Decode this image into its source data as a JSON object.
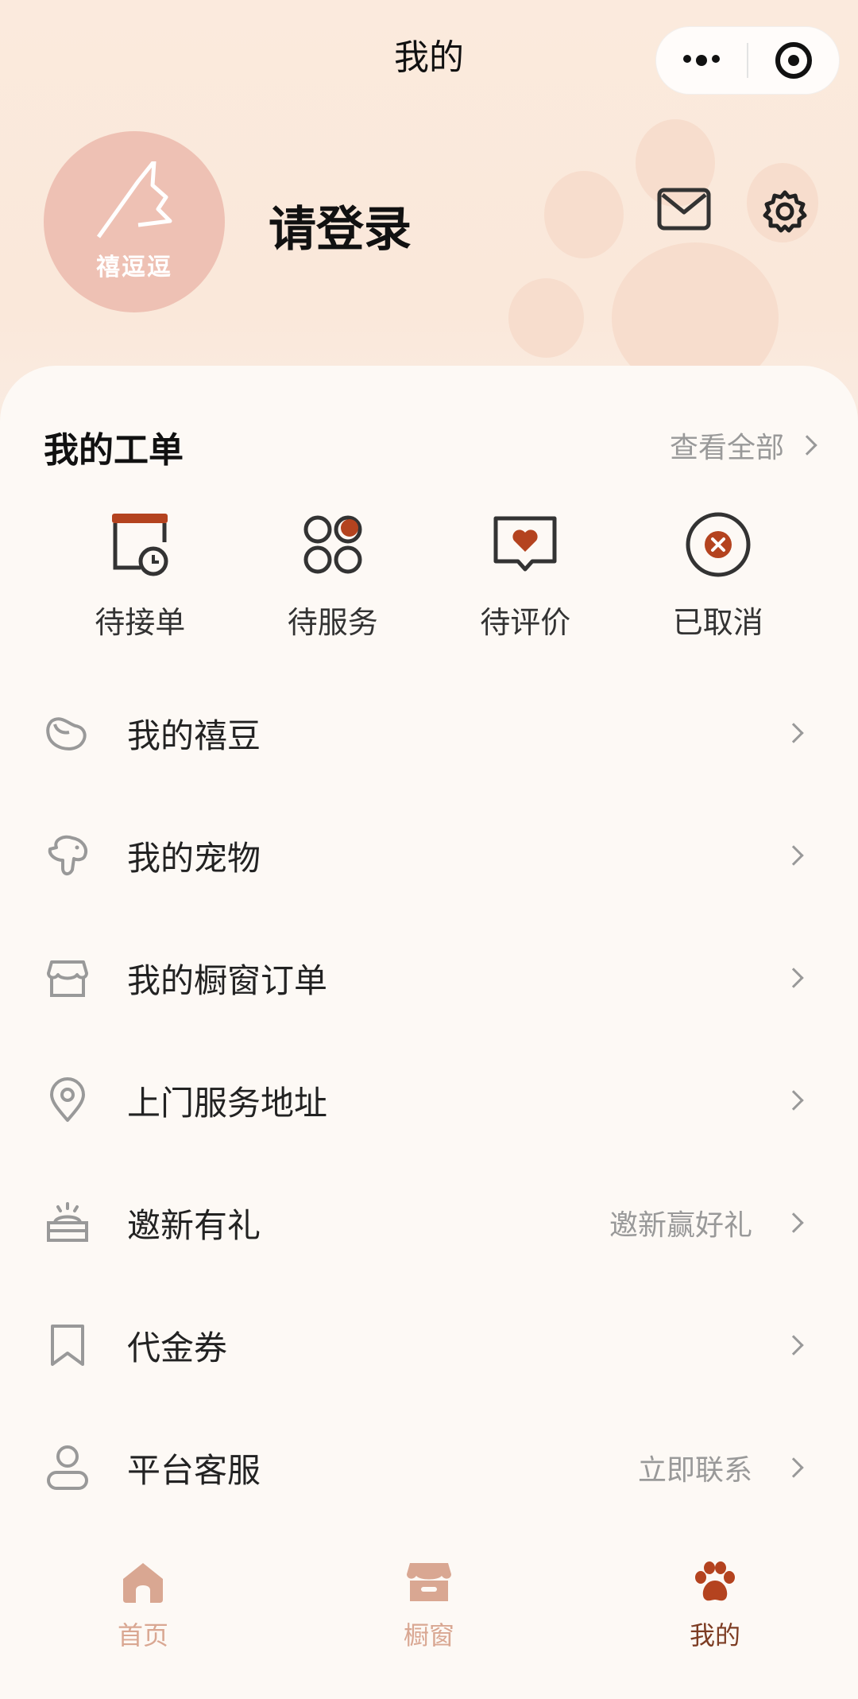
{
  "nav": {
    "title": "我的"
  },
  "profile": {
    "login_text": "请登录",
    "avatar_brand": "禧逗逗"
  },
  "orders": {
    "title": "我的工单",
    "view_all": "查看全部",
    "items": [
      {
        "label": "待接单",
        "icon": "pending-accept-icon"
      },
      {
        "label": "待服务",
        "icon": "pending-service-icon"
      },
      {
        "label": "待评价",
        "icon": "pending-review-icon"
      },
      {
        "label": "已取消",
        "icon": "cancelled-icon"
      }
    ]
  },
  "menu": [
    {
      "label": "我的禧豆",
      "extra": "",
      "icon": "bean-icon"
    },
    {
      "label": "我的宠物",
      "extra": "",
      "icon": "pet-icon"
    },
    {
      "label": "我的橱窗订单",
      "extra": "",
      "icon": "shop-icon"
    },
    {
      "label": "上门服务地址",
      "extra": "",
      "icon": "location-icon"
    },
    {
      "label": "邀新有礼",
      "extra": "邀新赢好礼",
      "icon": "gift-icon"
    },
    {
      "label": "代金券",
      "extra": "",
      "icon": "bookmark-icon"
    },
    {
      "label": "平台客服",
      "extra": "立即联系",
      "icon": "user-icon"
    }
  ],
  "tabs": [
    {
      "label": "首页",
      "icon": "home-icon",
      "active": false
    },
    {
      "label": "橱窗",
      "icon": "store-icon",
      "active": false
    },
    {
      "label": "我的",
      "icon": "paw-icon",
      "active": true
    }
  ],
  "colors": {
    "accent": "#b4431f",
    "tab_active": "#7d3d24",
    "tab_inactive": "#d9a792",
    "avatar_bg": "#eec1b4"
  }
}
